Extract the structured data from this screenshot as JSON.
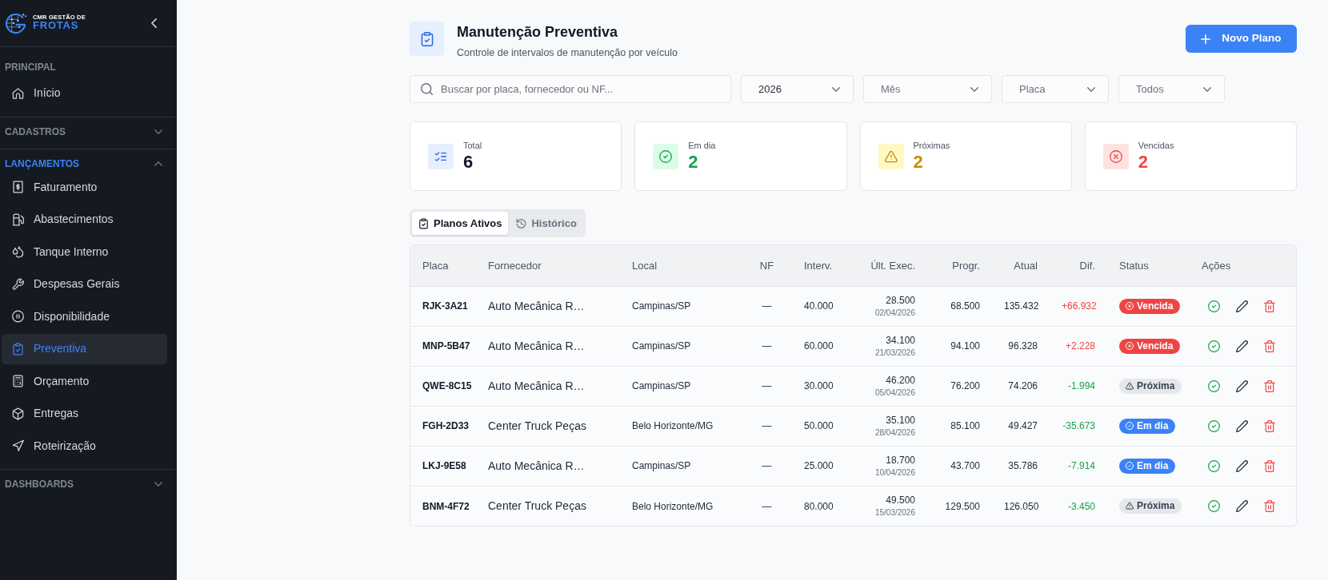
{
  "sidebar": {
    "logo": {
      "line_1": "CMR GESTÃO DE",
      "line_2": "FROTAS"
    },
    "sections": [
      {
        "title": "PRINCIPAL",
        "kind": "fixed",
        "expanded": true,
        "items": [
          {
            "label": "Início",
            "selected": false
          }
        ]
      },
      {
        "title": "CADASTROS",
        "kind": "collapsible",
        "expanded": false
      },
      {
        "title": "LANÇAMENTOS",
        "kind": "collapsible",
        "expanded": true,
        "items": [
          {
            "label": "Faturamento",
            "selected": false
          },
          {
            "label": "Abastecimentos",
            "selected": false
          },
          {
            "label": "Tanque Interno",
            "selected": false
          },
          {
            "label": "Despesas Gerais",
            "selected": false
          },
          {
            "label": "Disponibilidade",
            "selected": false
          },
          {
            "label": "Preventiva",
            "selected": true
          },
          {
            "label": "Orçamento",
            "selected": false
          },
          {
            "label": "Entregas",
            "selected": false
          },
          {
            "label": "Roteirização",
            "selected": false
          }
        ]
      },
      {
        "title": "DASHBOARDS",
        "kind": "collapsible",
        "expanded": false
      }
    ]
  },
  "header": {
    "title": "Manutenção Preventiva",
    "subtitle": "Controle de intervalos de manutenção por veículo",
    "button": "Novo Plano"
  },
  "filters": {
    "search": {
      "placeholder": "Buscar por placa, fornecedor ou NF..."
    },
    "selects": [
      {
        "value": "2026"
      },
      {
        "placeholder": "Mês"
      },
      {
        "placeholder": "Placa"
      },
      {
        "placeholder": "Todos"
      }
    ]
  },
  "stats": [
    {
      "label": "Total",
      "value": "6",
      "kind": "total"
    },
    {
      "label": "Em dia",
      "value": "2",
      "kind": "ok"
    },
    {
      "label": "Próximas",
      "value": "2",
      "kind": "upcoming"
    },
    {
      "label": "Vencidas",
      "value": "2",
      "kind": "overdue"
    }
  ],
  "tabs": [
    {
      "label": "Planos Ativos",
      "selected": true
    },
    {
      "label": "Histórico",
      "selected": false
    }
  ],
  "table": {
    "columns": [
      "Placa",
      "Fornecedor",
      "Local",
      "NF",
      "Interv.",
      "Últ. Exec.",
      "Progr.",
      "Atual",
      "Dif.",
      "Status",
      "Ações"
    ],
    "rows": [
      {
        "placa": "RJK-3A21",
        "fornecedor": "Auto Mecânica R…",
        "local": "Campinas/SP",
        "nf": "—",
        "interv": "40.000",
        "ult_exec": "28.500",
        "ult_exec_date": "02/04/2026",
        "progr": "68.500",
        "atual": "135.432",
        "dif": "+66.932",
        "status": {
          "label": "Vencida",
          "kind": "overdue"
        }
      },
      {
        "placa": "MNP-5B47",
        "fornecedor": "Auto Mecânica R…",
        "local": "Campinas/SP",
        "nf": "—",
        "interv": "60.000",
        "ult_exec": "34.100",
        "ult_exec_date": "21/03/2026",
        "progr": "94.100",
        "atual": "96.328",
        "dif": "+2.228",
        "status": {
          "label": "Vencida",
          "kind": "overdue"
        }
      },
      {
        "placa": "QWE-8C15",
        "fornecedor": "Auto Mecânica R…",
        "local": "Campinas/SP",
        "nf": "—",
        "interv": "30.000",
        "ult_exec": "46.200",
        "ult_exec_date": "05/04/2026",
        "progr": "76.200",
        "atual": "74.206",
        "dif": "-1.994",
        "status": {
          "label": "Próxima",
          "kind": "upcoming"
        }
      },
      {
        "placa": "FGH-2D33",
        "fornecedor": "Center Truck Peças",
        "local": "Belo Horizonte/MG",
        "nf": "—",
        "interv": "50.000",
        "ult_exec": "35.100",
        "ult_exec_date": "28/04/2026",
        "progr": "85.100",
        "atual": "49.427",
        "dif": "-35.673",
        "status": {
          "label": "Em dia",
          "kind": "ok"
        }
      },
      {
        "placa": "LKJ-9E58",
        "fornecedor": "Auto Mecânica R…",
        "local": "Campinas/SP",
        "nf": "—",
        "interv": "25.000",
        "ult_exec": "18.700",
        "ult_exec_date": "10/04/2026",
        "progr": "43.700",
        "atual": "35.786",
        "dif": "-7.914",
        "status": {
          "label": "Em dia",
          "kind": "ok"
        }
      },
      {
        "placa": "BNM-4F72",
        "fornecedor": "Center Truck Peças",
        "local": "Belo Horizonte/MG",
        "nf": "—",
        "interv": "80.000",
        "ult_exec": "49.500",
        "ult_exec_date": "15/03/2026",
        "progr": "129.500",
        "atual": "126.050",
        "dif": "-3.450",
        "status": {
          "label": "Próxima",
          "kind": "upcoming"
        }
      }
    ]
  }
}
